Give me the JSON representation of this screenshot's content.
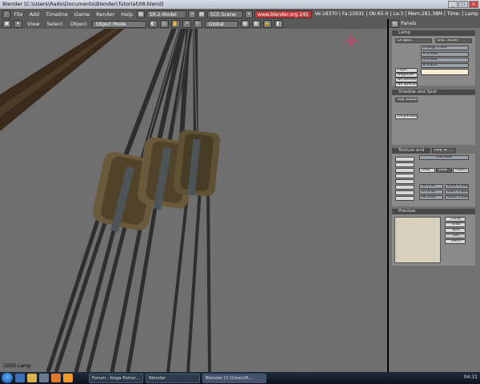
{
  "window": {
    "title": "Blender [C:\\Users\\Rado\\Documents\\Blender\\Tutorial\\08.blend]"
  },
  "info_header": {
    "menus": [
      "File",
      "Add",
      "Timeline",
      "Game",
      "Render",
      "Help"
    ],
    "screen": "SR:2-Model",
    "scene": "SCE:Scene",
    "url": "www.blender.org 245",
    "stats": "Ve:16370 | Fa:15931 | Ob:65-0 | La:3 | Mem:281.38M | Time: | Lamp"
  },
  "viewport_header": {
    "menus": [
      "View",
      "Select",
      "Object"
    ],
    "mode": "Object Mode",
    "orientation": "Global"
  },
  "viewport_status": "(250) Lamp",
  "panel_header": {
    "label": "Panels"
  },
  "lamp_panel": {
    "title": "Lamp",
    "name": "LA:Spot",
    "dist": "Dist: 30.00",
    "energy": "Energy 1.001",
    "r": "R 0.916",
    "g": "G 0.894",
    "b": "B 0.814",
    "buttons": [
      "Layer",
      "Negative",
      "No Diffuse",
      "No Specular"
    ],
    "color_swatch": "#f7ecd3"
  },
  "shadow_panel": {
    "title": "Shadow and Spot",
    "ray_shadow": "Ray Shadw",
    "only_shadow": "OnlyShadow"
  },
  "texture_panel": {
    "title": "Texture and Input",
    "tab": "Map To",
    "add_new": "Add New",
    "map_buttons": [
      "Glob",
      "View",
      "Object"
    ],
    "ofs": [
      "dX 0.00",
      "dY 0.00",
      "dZ 0.00"
    ],
    "size": [
      "sizeX 1.000",
      "sizeY 1.000",
      "sizeZ 1.000"
    ]
  },
  "preview_panel": {
    "title": "Preview",
    "types": [
      "Lamp",
      "Area",
      "Spot",
      "Sun",
      "Hemi"
    ]
  },
  "taskbar": {
    "tasks": [
      "Forum - Koga Portal...",
      "Blender",
      "Blender [C:\\Users\\R..."
    ],
    "clock": "04:31"
  }
}
